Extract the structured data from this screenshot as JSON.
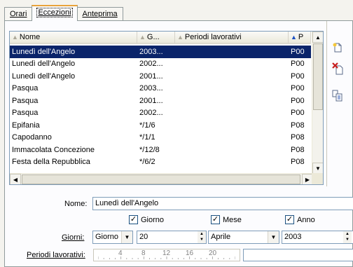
{
  "tabs": [
    {
      "label": "Orari",
      "active": false
    },
    {
      "label": "Eccezioni",
      "active": true
    },
    {
      "label": "Anteprima",
      "active": false
    }
  ],
  "grid": {
    "columns": [
      "Nome",
      "G...",
      "Periodi lavorativi",
      "P"
    ],
    "rows": [
      {
        "nome": "Lunedì dell'Angelo",
        "g": "2003...",
        "periodi": "",
        "p": "P00",
        "selected": true
      },
      {
        "nome": "Lunedì dell'Angelo",
        "g": "2002...",
        "periodi": "",
        "p": "P00"
      },
      {
        "nome": "Lunedì dell'Angelo",
        "g": "2001...",
        "periodi": "",
        "p": "P00"
      },
      {
        "nome": "Pasqua",
        "g": "2003...",
        "periodi": "",
        "p": "P00"
      },
      {
        "nome": "Pasqua",
        "g": "2001...",
        "periodi": "",
        "p": "P00"
      },
      {
        "nome": "Pasqua",
        "g": "2002...",
        "periodi": "",
        "p": "P00"
      },
      {
        "nome": "Epifania",
        "g": "*/1/6",
        "periodi": "",
        "p": "P08"
      },
      {
        "nome": "Capodanno",
        "g": "*/1/1",
        "periodi": "",
        "p": "P08"
      },
      {
        "nome": "Immacolata Concezione",
        "g": "*/12/8",
        "periodi": "",
        "p": "P08"
      },
      {
        "nome": "Festa della Repubblica",
        "g": "*/6/2",
        "periodi": "",
        "p": "P08"
      }
    ]
  },
  "form": {
    "nome_label": "Nome:",
    "nome_value": "Lunedì dell'Angelo",
    "giorno_label": "Giorno",
    "mese_label": "Mese",
    "anno_label": "Anno",
    "giorni_label": "Giorni:",
    "giorni_type": "Giorno",
    "giorno_value": "20",
    "mese_value": "Aprile",
    "anno_value": "2003",
    "periodi_label": "Periodi lavorativi:",
    "ruler_marks": [
      "4",
      "8",
      "12",
      "16",
      "20"
    ]
  },
  "icons": {
    "add": "new-document-icon",
    "delete": "delete-document-icon",
    "duplicate": "duplicate-document-icon"
  },
  "colors": {
    "selection": "#0a246a",
    "tab_highlight": "#e8a23a"
  }
}
